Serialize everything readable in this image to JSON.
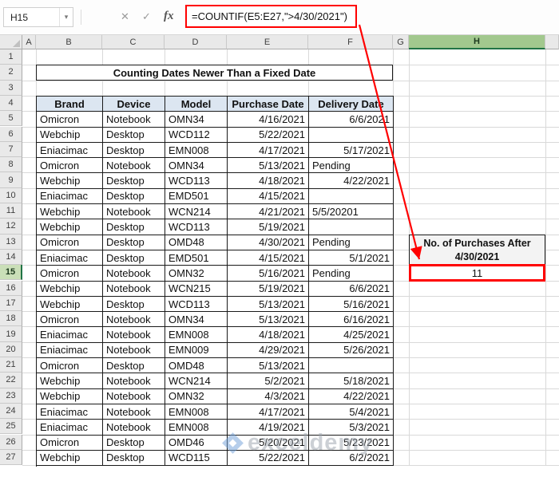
{
  "formula_bar": {
    "name_box": "H15",
    "cancel_icon": "✕",
    "enter_icon": "✓",
    "fx_icon": "fx",
    "formula": "=COUNTIF(E5:E27,\">4/30/2021\")"
  },
  "sheet": {
    "columns": [
      "A",
      "B",
      "C",
      "D",
      "E",
      "F",
      "G",
      "H"
    ],
    "rows_total": 27,
    "selected_column": "H",
    "selected_row": 15,
    "selected_cell": "H15"
  },
  "banner": {
    "title": "Counting Dates Newer Than a Fixed Date"
  },
  "table": {
    "first_data_row": 5,
    "headers": [
      "Brand",
      "Device",
      "Model",
      "Purchase Date",
      "Delivery Date"
    ],
    "rows": [
      [
        "Omicron",
        "Notebook",
        "OMN34",
        "4/16/2021",
        "6/6/2021"
      ],
      [
        "Webchip",
        "Desktop",
        "WCD112",
        "5/22/2021",
        ""
      ],
      [
        "Eniacimac",
        "Desktop",
        "EMN008",
        "4/17/2021",
        "5/17/2021"
      ],
      [
        "Omicron",
        "Notebook",
        "OMN34",
        "5/13/2021",
        "Pending"
      ],
      [
        "Webchip",
        "Desktop",
        "WCD113",
        "4/18/2021",
        "4/22/2021"
      ],
      [
        "Eniacimac",
        "Desktop",
        "EMD501",
        "4/15/2021",
        ""
      ],
      [
        "Webchip",
        "Notebook",
        "WCN214",
        "4/21/2021",
        "5/5/20201"
      ],
      [
        "Webchip",
        "Desktop",
        "WCD113",
        "5/19/2021",
        ""
      ],
      [
        "Omicron",
        "Desktop",
        "OMD48",
        "4/30/2021",
        "Pending"
      ],
      [
        "Eniacimac",
        "Desktop",
        "EMD501",
        "4/15/2021",
        "5/1/2021"
      ],
      [
        "Omicron",
        "Notebook",
        "OMN32",
        "5/16/2021",
        "Pending"
      ],
      [
        "Webchip",
        "Notebook",
        "WCN215",
        "5/19/2021",
        "6/6/2021"
      ],
      [
        "Webchip",
        "Desktop",
        "WCD113",
        "5/13/2021",
        "5/16/2021"
      ],
      [
        "Omicron",
        "Notebook",
        "OMN34",
        "5/13/2021",
        "6/16/2021"
      ],
      [
        "Eniacimac",
        "Notebook",
        "EMN008",
        "4/18/2021",
        "4/25/2021"
      ],
      [
        "Eniacimac",
        "Notebook",
        "EMN009",
        "4/29/2021",
        "5/26/2021"
      ],
      [
        "Omicron",
        "Desktop",
        "OMD48",
        "5/13/2021",
        ""
      ],
      [
        "Webchip",
        "Notebook",
        "WCN214",
        "5/2/2021",
        "5/18/2021"
      ],
      [
        "Webchip",
        "Notebook",
        "OMN32",
        "4/3/2021",
        "4/22/2021"
      ],
      [
        "Eniacimac",
        "Notebook",
        "EMN008",
        "4/17/2021",
        "5/4/2021"
      ],
      [
        "Eniacimac",
        "Notebook",
        "EMN008",
        "4/19/2021",
        "5/3/2021"
      ],
      [
        "Omicron",
        "Desktop",
        "OMD46",
        "5/20/2021",
        "5/23/2021"
      ],
      [
        "Webchip",
        "Desktop",
        "WCD115",
        "5/22/2021",
        "6/2/2021"
      ]
    ]
  },
  "result_panel": {
    "label_line1": "No. of Purchases After",
    "label_line2": "4/30/2021",
    "value": "11"
  },
  "watermark": {
    "text": "exceldemy"
  },
  "colors": {
    "annotation_red": "#ff0000",
    "selection_green": "#217346",
    "selected_col_header_fill": "#a2c88e",
    "selected_row_header_fill": "#cadfb8",
    "table_header_fill": "#dce6f1",
    "panel_label_fill": "#f3f3f3",
    "header_fill": "#e9e9e9",
    "gridline": "#d9d9d9",
    "table_border": "#1a1a1a"
  }
}
